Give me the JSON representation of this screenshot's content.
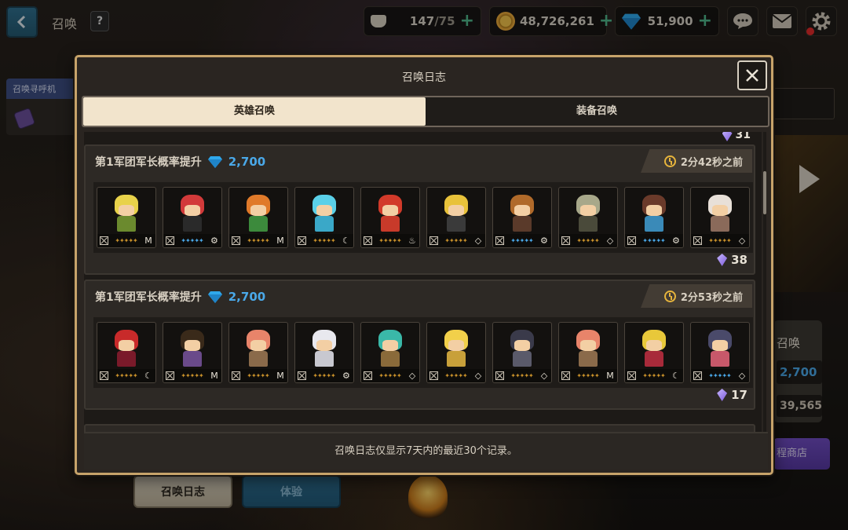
{
  "top_bar": {
    "title": "召唤",
    "help_label": "?",
    "stamina": {
      "value": "147",
      "limit": "/75"
    },
    "gold": "48,726,261",
    "gems": "51,900",
    "icons": [
      "chat-icon",
      "mail-icon",
      "settings-icon"
    ]
  },
  "side_tab": {
    "label": "召唤寻呼机"
  },
  "bottom_buttons": {
    "log": "召唤日志",
    "trial": "体验"
  },
  "right_panel": {
    "summon_label": "召唤",
    "cost": "2,700",
    "count": "39,565",
    "shop": "程商店"
  },
  "modal": {
    "title": "召唤日志",
    "tabs": [
      {
        "label": "英雄召唤",
        "active": true
      },
      {
        "label": "装备召唤",
        "active": false
      }
    ],
    "top_partial_count": "31",
    "records": [
      {
        "title": "第1军团军长概率提升",
        "cost": "2,700",
        "time": "2分42秒之前",
        "shards": "38",
        "heroes": [
          {
            "hair": "#e8d24a",
            "body": "#6b8a2e",
            "stars": "gold",
            "el": "M"
          },
          {
            "hair": "#d23a3a",
            "body": "#2a2a2a",
            "stars": "blue",
            "el": "⚙"
          },
          {
            "hair": "#e07a2a",
            "body": "#3c8a3c",
            "stars": "gold",
            "el": "M"
          },
          {
            "hair": "#5ad0e8",
            "body": "#3aa8c8",
            "stars": "gold",
            "el": "☾"
          },
          {
            "hair": "#d23a2a",
            "body": "#c83a2a",
            "stars": "gold",
            "el": "♨"
          },
          {
            "hair": "#e8c23a",
            "body": "#3a3a3a",
            "stars": "gold",
            "el": "◇"
          },
          {
            "hair": "#b06a2a",
            "body": "#5a3a2a",
            "stars": "blue",
            "el": "⚙"
          },
          {
            "hair": "#a8a88a",
            "body": "#4a4a3a",
            "stars": "gold",
            "el": "◇"
          },
          {
            "hair": "#6a3a2a",
            "body": "#3a8ab8",
            "stars": "blue",
            "el": "⚙"
          },
          {
            "hair": "#e8e0d8",
            "body": "#8a6a5a",
            "stars": "gold",
            "el": "◇"
          }
        ]
      },
      {
        "title": "第1军团军长概率提升",
        "cost": "2,700",
        "time": "2分53秒之前",
        "shards": "17",
        "heroes": [
          {
            "hair": "#c82a2a",
            "body": "#7a1a2a",
            "stars": "gold",
            "el": "☾"
          },
          {
            "hair": "#3a2a1a",
            "body": "#6a4a8a",
            "stars": "gold",
            "el": "M"
          },
          {
            "hair": "#e8846a",
            "body": "#8a6a4a",
            "stars": "gold",
            "el": "M"
          },
          {
            "hair": "#e8e8ee",
            "body": "#c8c8d0",
            "stars": "gold",
            "el": "⚙"
          },
          {
            "hair": "#3ab8a8",
            "body": "#8a6a3a",
            "stars": "gold",
            "el": "◇"
          },
          {
            "hair": "#f2d04a",
            "body": "#c8a03a",
            "stars": "gold",
            "el": "◇"
          },
          {
            "hair": "#3a3a4a",
            "body": "#5a5a6a",
            "stars": "gold",
            "el": "◇"
          },
          {
            "hair": "#e8846a",
            "body": "#8a6a4a",
            "stars": "gold",
            "el": "M"
          },
          {
            "hair": "#e8c83a",
            "body": "#a82a3a",
            "stars": "gold",
            "el": "☾"
          },
          {
            "hair": "#4a4a6a",
            "body": "#c8586a",
            "stars": "blue",
            "el": "◇"
          }
        ]
      }
    ],
    "footer_note": "召唤日志仅显示7天内的最近30个记录。"
  },
  "colors": {
    "accent_blue": "#4aa8e8",
    "gold_border": "#c7a36a",
    "tab_active": "#f2e4cc"
  }
}
